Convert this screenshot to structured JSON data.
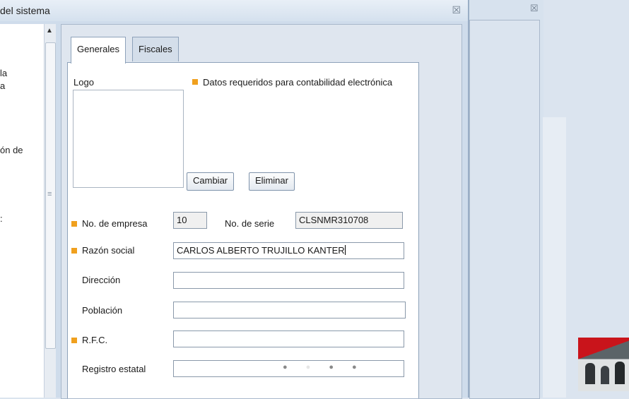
{
  "window": {
    "title": "del sistema",
    "close_glyph": "☒"
  },
  "left_pane": {
    "fragments": [
      "la",
      "a",
      "ón de",
      ":"
    ]
  },
  "tabs": [
    {
      "label": "Generales",
      "active": true
    },
    {
      "label": "Fiscales",
      "active": false
    }
  ],
  "form": {
    "logo_label": "Logo",
    "required_note": "Datos requeridos para contabilidad electrónica",
    "required_color": "#f0a01e",
    "cambiar_label": "Cambiar",
    "eliminar_label": "Eliminar",
    "no_empresa_label": "No. de empresa",
    "no_empresa_value": "10",
    "no_serie_label": "No. de serie",
    "no_serie_value": "CLSNMR310708",
    "razon_label": "Razón social",
    "razon_value": "CARLOS ALBERTO TRUJILLO KANTER",
    "direccion_label": "Dirección",
    "direccion_value": "",
    "poblacion_label": "Población",
    "poblacion_value": "",
    "rfc_label": "R.F.C.",
    "rfc_value": "",
    "registro_label": "Registro estatal",
    "registro_value": ""
  },
  "second_window": {
    "close_glyph": "☒"
  },
  "icons": [
    "close-icon",
    "scroll-up-arrow-icon",
    "scroll-grip-icon",
    "required-indicator-icon",
    "loading-dots-icon"
  ]
}
